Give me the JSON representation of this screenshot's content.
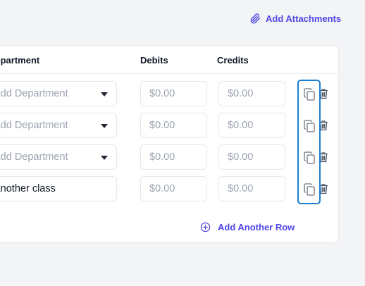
{
  "header": {
    "add_attachments_label": "Add Attachments",
    "attachment_icon": "paperclip-icon"
  },
  "table": {
    "columns": {
      "department": "Department",
      "debits": "Debits",
      "credits": "Credits"
    },
    "rows": [
      {
        "department": "Add Department",
        "department_is_placeholder": true,
        "debit_placeholder": "$0.00",
        "credit_placeholder": "$0.00"
      },
      {
        "department": "Add Department",
        "department_is_placeholder": true,
        "debit_placeholder": "$0.00",
        "credit_placeholder": "$0.00"
      },
      {
        "department": "Add Department",
        "department_is_placeholder": true,
        "debit_placeholder": "$0.00",
        "credit_placeholder": "$0.00"
      },
      {
        "department": "Another class",
        "department_is_placeholder": false,
        "debit_placeholder": "$0.00",
        "credit_placeholder": "$0.00"
      }
    ],
    "row_action_icons": [
      "copy-icon",
      "trash-icon"
    ],
    "add_row_label": "Add Another Row",
    "add_row_icon": "plus-circle-icon"
  },
  "colors": {
    "accent": "#4f46e5",
    "highlight_border": "#1b7fd1",
    "placeholder_text": "#9ca3af",
    "page_background": "#f3f4f6",
    "card_background": "#ffffff"
  }
}
